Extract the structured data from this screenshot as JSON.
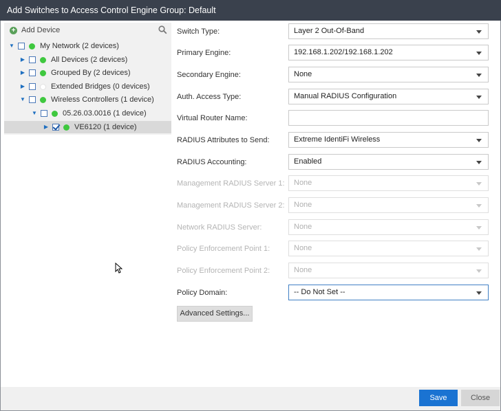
{
  "dialog": {
    "title": "Add Switches to Access Control Engine Group: Default"
  },
  "tree": {
    "add_device_label": "Add Device",
    "items": [
      {
        "label": "My Network (2 devices)",
        "expanded": true,
        "dot": "green"
      },
      {
        "label": "All Devices (2 devices)",
        "expanded": false,
        "dot": "green"
      },
      {
        "label": "Grouped By (2 devices)",
        "expanded": false,
        "dot": "green"
      },
      {
        "label": "Extended Bridges (0 devices)",
        "expanded": false,
        "dot": "empty"
      },
      {
        "label": "Wireless Controllers (1 device)",
        "expanded": true,
        "dot": "green"
      },
      {
        "label": "05.26.03.0016 (1 device)",
        "expanded": true,
        "dot": "green"
      },
      {
        "label": "VE6120 (1 device)",
        "expanded": false,
        "dot": "green",
        "checked": true,
        "selected": true
      }
    ]
  },
  "form": {
    "fields": [
      {
        "label": "Switch Type:",
        "value": "Layer 2 Out-Of-Band",
        "type": "select",
        "enabled": true
      },
      {
        "label": "Primary Engine:",
        "value": "192.168.1.202/192.168.1.202",
        "type": "select",
        "enabled": true
      },
      {
        "label": "Secondary Engine:",
        "value": "None",
        "type": "select",
        "enabled": true
      },
      {
        "label": "Auth. Access Type:",
        "value": "Manual RADIUS Configuration",
        "type": "select",
        "enabled": true
      },
      {
        "label": "Virtual Router Name:",
        "value": "",
        "type": "text",
        "enabled": true
      },
      {
        "label": "RADIUS Attributes to Send:",
        "value": "Extreme IdentiFi Wireless",
        "type": "select",
        "enabled": true
      },
      {
        "label": "RADIUS Accounting:",
        "value": "Enabled",
        "type": "select",
        "enabled": true
      },
      {
        "label": "Management RADIUS Server 1:",
        "value": "None",
        "type": "select",
        "enabled": false
      },
      {
        "label": "Management RADIUS Server 2:",
        "value": "None",
        "type": "select",
        "enabled": false
      },
      {
        "label": "Network RADIUS Server:",
        "value": "None",
        "type": "select",
        "enabled": false
      },
      {
        "label": "Policy Enforcement Point 1:",
        "value": "None",
        "type": "select",
        "enabled": false
      },
      {
        "label": "Policy Enforcement Point 2:",
        "value": "None",
        "type": "select",
        "enabled": false
      },
      {
        "label": "Policy Domain:",
        "value": "-- Do Not Set --",
        "type": "select",
        "enabled": true,
        "focused": true
      }
    ],
    "advanced_button": "Advanced Settings..."
  },
  "footer": {
    "save_label": "Save",
    "close_label": "Close"
  },
  "colors": {
    "title_bar": "#3a414d",
    "primary_button": "#1a73d2",
    "status_green": "#3fc83f"
  }
}
